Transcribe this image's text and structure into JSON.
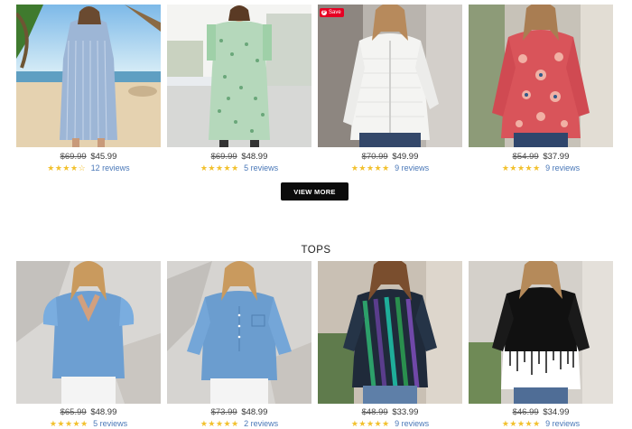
{
  "featured": {
    "items": [
      {
        "old_price": "$69.99",
        "price": "$45.99",
        "stars": "★★★★☆",
        "reviews": "12 reviews",
        "image": "striped-jumpsuit-photo"
      },
      {
        "old_price": "$69.99",
        "price": "$48.99",
        "stars": "★★★★★",
        "reviews": "5 reviews",
        "image": "green-floral-jumpsuit-photo"
      },
      {
        "old_price": "$70.99",
        "price": "$49.99",
        "stars": "★★★★★",
        "reviews": "9 reviews",
        "image": "white-cardigan-photo",
        "badge": "Save"
      },
      {
        "old_price": "$54.99",
        "price": "$37.99",
        "stars": "★★★★★",
        "reviews": "9 reviews",
        "image": "red-paisley-blouse-photo"
      }
    ],
    "view_more_label": "VIEW MORE"
  },
  "tops": {
    "title": "TOPS",
    "items": [
      {
        "old_price": "$65.99",
        "price": "$48.99",
        "stars": "★★★★★",
        "reviews": "5 reviews",
        "image": "denim-puff-sleeve-top-photo"
      },
      {
        "old_price": "$73.99",
        "price": "$48.99",
        "stars": "★★★★★",
        "reviews": "2 reviews",
        "image": "denim-button-top-photo"
      },
      {
        "old_price": "$48.99",
        "price": "$33.99",
        "stars": "★★★★★",
        "reviews": "9 reviews",
        "image": "green-stripe-tunic-photo"
      },
      {
        "old_price": "$46.99",
        "price": "$34.99",
        "stars": "★★★★★",
        "reviews": "9 reviews",
        "image": "black-white-gradient-top-photo"
      }
    ]
  },
  "colors": {
    "star": "#f2c12e",
    "review_link": "#4a78b8",
    "button_bg": "#0b0b0b",
    "save_badge": "#e60023"
  }
}
